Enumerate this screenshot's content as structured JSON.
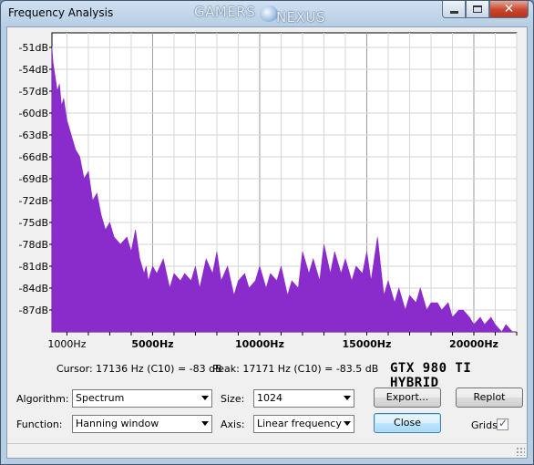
{
  "window": {
    "title": "Frequency Analysis",
    "watermark_left": "GAMERS",
    "watermark_right": "NEXUS",
    "caption_buttons": [
      "minimize",
      "maximize",
      "close"
    ]
  },
  "chart_data": {
    "type": "area",
    "title": "",
    "xlabel": "",
    "ylabel": "",
    "x_ticks": [
      "1000Hz",
      "5000Hz",
      "10000Hz",
      "15000Hz",
      "20000Hz"
    ],
    "x_tick_values": [
      1000,
      5000,
      10000,
      15000,
      20000
    ],
    "y_ticks": [
      "-51dB",
      "-54dB",
      "-57dB",
      "-60dB",
      "-63dB",
      "-66dB",
      "-69dB",
      "-72dB",
      "-75dB",
      "-78dB",
      "-81dB",
      "-84dB",
      "-87dB"
    ],
    "y_tick_values": [
      -51,
      -54,
      -57,
      -60,
      -63,
      -66,
      -69,
      -72,
      -75,
      -78,
      -81,
      -84,
      -87
    ],
    "xlim": [
      300,
      22000
    ],
    "ylim": [
      -90,
      -49
    ],
    "grid": true,
    "series": [
      {
        "color": "#8a2bcc",
        "x": [
          300,
          350,
          450,
          550,
          650,
          750,
          850,
          1000,
          1200,
          1400,
          1600,
          1800,
          2000,
          2200,
          2400,
          2600,
          2800,
          3000,
          3200,
          3500,
          3800,
          4000,
          4200,
          4400,
          4600,
          4700,
          4800,
          5000,
          5200,
          5500,
          5800,
          6000,
          6300,
          6500,
          6800,
          7000,
          7200,
          7500,
          7800,
          8000,
          8200,
          8500,
          8800,
          9000,
          9300,
          9500,
          9800,
          10000,
          10300,
          10500,
          10800,
          11000,
          11300,
          11500,
          11800,
          12000,
          12300,
          12500,
          12800,
          13000,
          13300,
          13500,
          13800,
          14000,
          14300,
          14500,
          14800,
          15000,
          15200,
          15500,
          15800,
          16000,
          16300,
          16500,
          16800,
          17000,
          17300,
          17500,
          17800,
          18000,
          18300,
          18500,
          18800,
          19000,
          19300,
          19500,
          19800,
          20000,
          20300,
          20500,
          20800,
          21000,
          21300,
          21500,
          21800,
          22000
        ],
        "y": [
          -51,
          -53,
          -55,
          -57,
          -56,
          -59,
          -58,
          -61,
          -63,
          -65,
          -66,
          -69,
          -68,
          -72,
          -71,
          -74,
          -76,
          -75,
          -77,
          -78,
          -77,
          -79,
          -76,
          -80,
          -82,
          -81,
          -83,
          -81,
          -82,
          -80,
          -84,
          -82,
          -83,
          -82,
          -83,
          -81,
          -84,
          -80,
          -82,
          -79,
          -83,
          -81,
          -85,
          -83,
          -82,
          -84,
          -83,
          -81,
          -84,
          -82,
          -83,
          -81,
          -85,
          -83,
          -84,
          -79,
          -82,
          -80,
          -83,
          -78,
          -82,
          -79,
          -82,
          -80,
          -83,
          -81,
          -82,
          -79,
          -83,
          -77,
          -85,
          -83,
          -86,
          -84,
          -87,
          -85,
          -86,
          -84,
          -87,
          -86,
          -86,
          -87,
          -86,
          -88,
          -87,
          -87,
          -88,
          -89,
          -88,
          -89,
          -88,
          -89,
          -90,
          -89,
          -90,
          -90
        ]
      }
    ]
  },
  "status": {
    "cursor": "Cursor: 17136 Hz (C10) = -83 dB",
    "peak": "Peak: 17171 Hz (C10) = -83.5 dB"
  },
  "overlay_label": "GTX 980 TI HYBRID",
  "controls": {
    "algorithm_label": "Algorithm:",
    "algorithm_value": "Spectrum",
    "function_label": "Function:",
    "function_value": "Hanning window",
    "size_label": "Size:",
    "size_value": "1024",
    "axis_label": "Axis:",
    "axis_value": "Linear frequency",
    "export_label": "Export...",
    "replot_label": "Replot",
    "close_label": "Close",
    "grids_label": "Grids",
    "grids_checked": true
  }
}
